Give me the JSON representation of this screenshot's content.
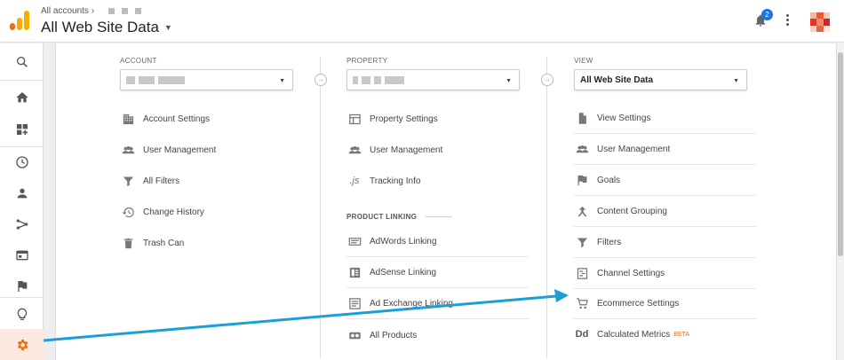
{
  "header": {
    "breadcrumb": "All accounts",
    "breadcrumb_chevron": "›",
    "view_title": "All Web Site Data",
    "notification_count": "2"
  },
  "rail": {
    "items": [
      {
        "icon": "search-icon"
      },
      {
        "icon": "home-icon"
      },
      {
        "icon": "customization-icon"
      },
      {
        "icon": "realtime-clock-icon"
      },
      {
        "icon": "audience-person-icon"
      },
      {
        "icon": "acquisition-icon"
      },
      {
        "icon": "behavior-icon"
      },
      {
        "icon": "conversions-flag-icon"
      },
      {
        "icon": "discover-lightbulb-icon"
      },
      {
        "icon": "admin-gear-icon"
      }
    ],
    "active_color": "#e8710a"
  },
  "columns": {
    "account": {
      "label": "ACCOUNT",
      "items": [
        {
          "label": "Account Settings",
          "icon": "building-icon"
        },
        {
          "label": "User Management",
          "icon": "people-icon"
        },
        {
          "label": "All Filters",
          "icon": "filter-icon"
        },
        {
          "label": "Change History",
          "icon": "history-icon"
        },
        {
          "label": "Trash Can",
          "icon": "trash-icon"
        }
      ]
    },
    "property": {
      "label": "PROPERTY",
      "items": [
        {
          "label": "Property Settings",
          "icon": "window-icon"
        },
        {
          "label": "User Management",
          "icon": "people-icon"
        },
        {
          "label": "Tracking Info",
          "icon": "js-icon"
        }
      ],
      "section_title": "PRODUCT LINKING",
      "linking": [
        {
          "label": "AdWords Linking",
          "icon": "adwords-icon"
        },
        {
          "label": "AdSense Linking",
          "icon": "adsense-icon"
        },
        {
          "label": "Ad Exchange Linking",
          "icon": "adexchange-icon"
        },
        {
          "label": "All Products",
          "icon": "link-icon"
        }
      ]
    },
    "view": {
      "label": "VIEW",
      "selected": "All Web Site Data",
      "items": [
        {
          "label": "View Settings",
          "icon": "document-icon"
        },
        {
          "label": "User Management",
          "icon": "people-icon"
        },
        {
          "label": "Goals",
          "icon": "goal-flag-icon"
        },
        {
          "label": "Content Grouping",
          "icon": "content-grouping-icon"
        },
        {
          "label": "Filters",
          "icon": "filter-icon"
        },
        {
          "label": "Channel Settings",
          "icon": "channel-icon"
        },
        {
          "label": "Ecommerce Settings",
          "icon": "cart-icon"
        },
        {
          "label": "Calculated Metrics",
          "icon": "dd-icon",
          "badge": "BETA"
        }
      ]
    }
  },
  "annotation": {
    "arrow_color": "#1a9fd9"
  }
}
